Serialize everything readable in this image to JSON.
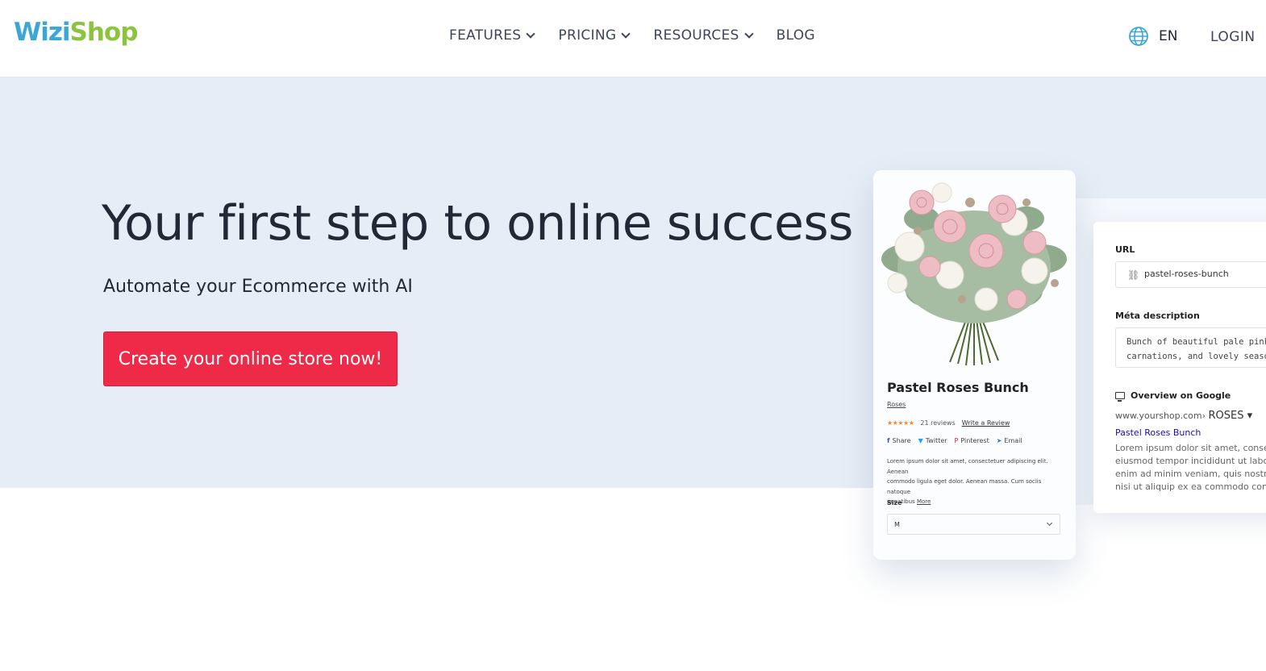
{
  "brand": {
    "part1": "Wizi",
    "part2": "Shop",
    "color1": "#3aa7d8",
    "color2": "#8cc43f"
  },
  "nav": {
    "items": [
      {
        "label": "FEATURES",
        "dropdown": true
      },
      {
        "label": "PRICING",
        "dropdown": true
      },
      {
        "label": "RESOURCES",
        "dropdown": true
      },
      {
        "label": "BLOG",
        "dropdown": false
      }
    ],
    "language": "EN",
    "language_icon": "globe-icon",
    "login": "LOGIN"
  },
  "hero": {
    "headline": "Your first step to online success",
    "subheadline": "Automate your Ecommerce with AI",
    "cta": "Create your online store now!",
    "background": "#e6edf6",
    "cta_color": "#ef2a48"
  },
  "product": {
    "title": "Pastel Roses Bunch",
    "category": "Roses",
    "stars": "★★★★★",
    "reviews": "21 reviews",
    "write_review": "Write a Review",
    "share": [
      {
        "icon": "facebook-icon",
        "glyph": "f",
        "label": "Share"
      },
      {
        "icon": "twitter-icon",
        "glyph": "🐦",
        "label": "Twitter"
      },
      {
        "icon": "pinterest-icon",
        "glyph": "℗",
        "label": "Pinterest"
      },
      {
        "icon": "email-icon",
        "glyph": "➤",
        "label": "Email"
      }
    ],
    "description_line1": "Lorem ipsum dolor sit amet, consectetuer adipiscing elit. Aenean",
    "description_line2": "commodo ligula eget dolor. Aenean massa. Cum sociis natoque",
    "description_line3": "penatibus",
    "more": "More",
    "size_label": "Size",
    "size_value": "M"
  },
  "seo": {
    "url_label": "URL",
    "url_value": "pastel-roses-bunch",
    "meta_label": "Méta description",
    "meta_line1": "Bunch of beautiful pale pink rose",
    "meta_line2": "carnations, and lovely seasonal f",
    "google_label": "Overview on Google",
    "google_domain": "www.yourshop.com›",
    "google_path": "ROSES ▾",
    "google_title": "Pastel Roses Bunch",
    "google_desc1": "Lorem ipsum dolor sit amet, consectetu",
    "google_desc2": "eiusmod tempor incididunt ut labore et",
    "google_desc3": "enim ad minim veniam, quis nostrud ex",
    "google_desc4": "nisi ut aliquip ex ea commodo consequ"
  }
}
